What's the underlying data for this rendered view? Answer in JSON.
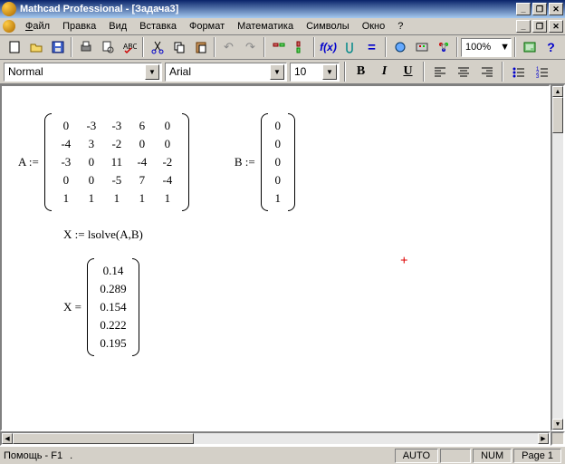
{
  "window": {
    "title": "Mathcad Professional - [Задача3]"
  },
  "menu": {
    "file": "Файл",
    "edit": "Правка",
    "view": "Вид",
    "insert": "Вставка",
    "format": "Формат",
    "math": "Математика",
    "symbols": "Символы",
    "window": "Окно",
    "help": "?"
  },
  "format": {
    "style": "Normal",
    "font": "Arial",
    "size": "10",
    "zoom": "100%"
  },
  "status": {
    "help": "Помощь - F1",
    "auto": "AUTO",
    "num": "NUM",
    "page": "Page 1"
  },
  "doc": {
    "A_label": "A :=",
    "A": [
      [
        "0",
        "-3",
        "-3",
        "6",
        "0"
      ],
      [
        "-4",
        "3",
        "-2",
        "0",
        "0"
      ],
      [
        "-3",
        "0",
        "11",
        "-4",
        "-2"
      ],
      [
        "0",
        "0",
        "-5",
        "7",
        "-4"
      ],
      [
        "1",
        "1",
        "1",
        "1",
        "1"
      ]
    ],
    "B_label": "B :=",
    "B": [
      [
        "0"
      ],
      [
        "0"
      ],
      [
        "0"
      ],
      [
        "0"
      ],
      [
        "1"
      ]
    ],
    "X_def": "X := lsolve(A,B)",
    "X_label": "X =",
    "X": [
      [
        "0.14"
      ],
      [
        "0.289"
      ],
      [
        "0.154"
      ],
      [
        "0.222"
      ],
      [
        "0.195"
      ]
    ]
  }
}
